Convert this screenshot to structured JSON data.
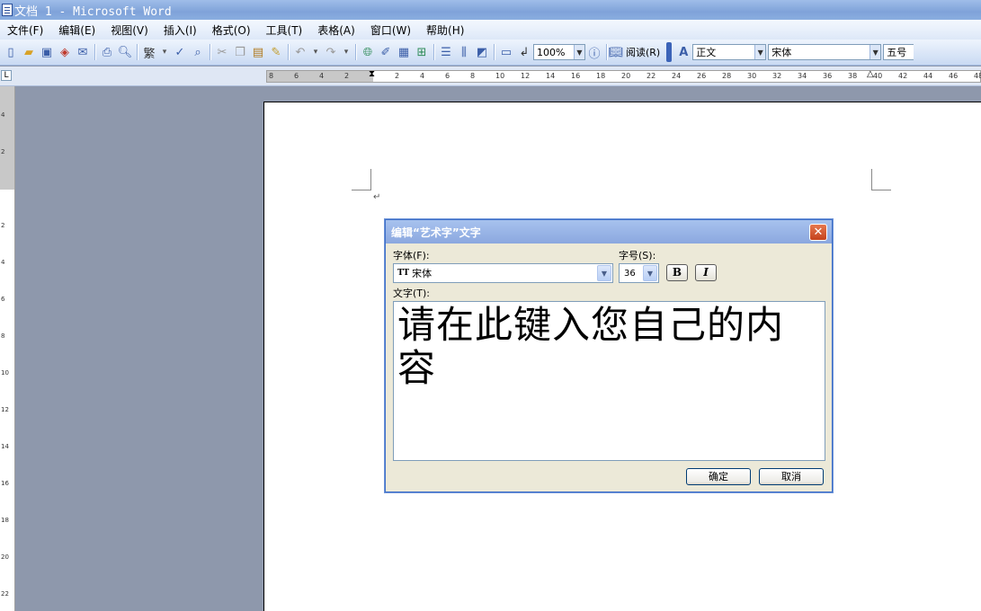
{
  "window": {
    "title": "文档 1 - Microsoft Word"
  },
  "menubar": {
    "items": [
      "文件(F)",
      "编辑(E)",
      "视图(V)",
      "插入(I)",
      "格式(O)",
      "工具(T)",
      "表格(A)",
      "窗口(W)",
      "帮助(H)"
    ]
  },
  "toolbar": {
    "traditional_label": "繁",
    "zoom": "100%",
    "read_label": "阅读(R)",
    "style": "正文",
    "font": "宋体",
    "size": "五号"
  },
  "ruler": {
    "tab_selector": "L",
    "horizontal_ticks": [
      "8",
      "6",
      "4",
      "2",
      "2",
      "4",
      "6",
      "8",
      "10",
      "12",
      "14",
      "16",
      "18",
      "20",
      "22",
      "24",
      "26",
      "28",
      "30",
      "32",
      "34",
      "36",
      "38",
      "40",
      "42",
      "44",
      "46",
      "48"
    ],
    "vertical_ticks": [
      "4",
      "2",
      "2",
      "4",
      "6",
      "8",
      "10",
      "12",
      "14",
      "16",
      "18",
      "20",
      "22"
    ]
  },
  "document": {
    "paragraph_mark": "↵"
  },
  "dialog": {
    "title": "编辑“艺术字”文字",
    "close_label": "✕",
    "font_label": "字体(F):",
    "font_value": "宋体",
    "size_label": "字号(S):",
    "size_value": "36",
    "bold_label": "B",
    "italic_label": "I",
    "text_label": "文字(T):",
    "text_value": "请在此键入您自己的内容",
    "ok_label": "确定",
    "cancel_label": "取消"
  }
}
